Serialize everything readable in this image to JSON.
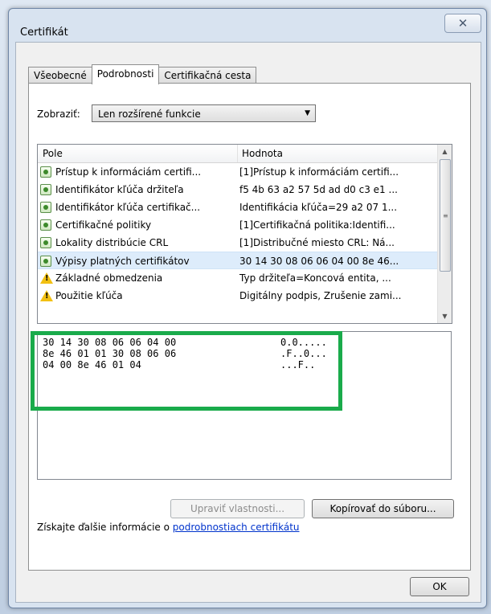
{
  "window": {
    "title": "Certifikát",
    "close_glyph": "✕"
  },
  "tabs": [
    {
      "label": "Všeobecné",
      "active": false
    },
    {
      "label": "Podrobnosti",
      "active": true
    },
    {
      "label": "Certifikačná cesta",
      "active": false
    }
  ],
  "show": {
    "label": "Zobraziť:",
    "value": "Len rozšírené funkcie"
  },
  "list": {
    "columns": [
      "Pole",
      "Hodnota"
    ],
    "rows": [
      {
        "field": "Prístup k informáciám certifi...",
        "value": "[1]Prístup k informáciám certifi...",
        "icon": "certificate-field-icon"
      },
      {
        "field": "Identifikátor kľúča držiteľa",
        "value": "f5 4b 63 a2 57 5d ad d0 c3 e1 ...",
        "icon": "certificate-field-icon"
      },
      {
        "field": "Identifikátor kľúča certifikač...",
        "value": "Identifikácia kľúča=29 a2 07 1...",
        "icon": "certificate-field-icon"
      },
      {
        "field": "Certifikačné politiky",
        "value": "[1]Certifikačná politika:Identifi...",
        "icon": "certificate-field-icon"
      },
      {
        "field": "Lokality distribúcie CRL",
        "value": "[1]Distribučné miesto CRL: Ná...",
        "icon": "certificate-field-icon"
      },
      {
        "field": "Výpisy platných certifikátov",
        "value": "30 14 30 08 06 06 04 00 8e 46...",
        "icon": "certificate-field-icon"
      },
      {
        "field": "Základné obmedzenia",
        "value": "Typ držiteľa=Koncová entita, ...",
        "icon": "warning-icon"
      },
      {
        "field": "Použitie kľúča",
        "value": "Digitálny podpis, Zrušenie zami...",
        "icon": "warning-icon"
      }
    ],
    "selected_index": 5
  },
  "hex": [
    {
      "bytes": "30 14 30 08 06 06 04 00",
      "ascii": "0.0....."
    },
    {
      "bytes": "8e 46 01 01 30 08 06 06",
      "ascii": ".F..0..."
    },
    {
      "bytes": "04 00 8e 46 01 04",
      "ascii": "...F.."
    }
  ],
  "buttons": {
    "edit_properties": "Upraviť vlastnosti...",
    "copy_to_file": "Kopírovať do súboru...",
    "ok": "OK"
  },
  "info": {
    "prefix": "Získajte ďalšie informácie o ",
    "link": "podrobnostiach certifikátu"
  },
  "colors": {
    "highlight": "#1aab4b",
    "link": "#0033cc",
    "selected_row": "#ddecfb"
  }
}
